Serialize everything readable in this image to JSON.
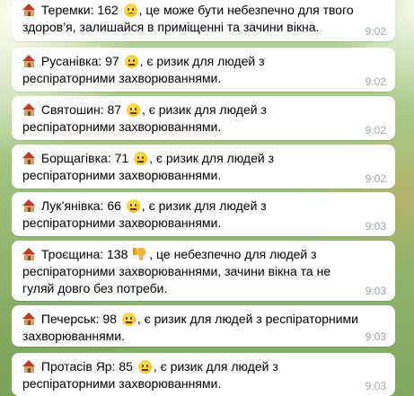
{
  "messages": [
    {
      "text_pre": "Теремки: 162",
      "emoji": "neutral-face-icon",
      "text_post": ", це може бути небезпечно для твого здоров’я, залишайся в приміщенні та зачини вікна.",
      "time": "9:02"
    },
    {
      "text_pre": "Русанівка: 97",
      "emoji": "neutral-face-icon",
      "text_post": ", є ризик для людей з респіраторними захворюваннями.",
      "time": "9:02"
    },
    {
      "text_pre": "Святошин: 87",
      "emoji": "neutral-face-icon",
      "text_post": ", є ризик для людей з респіраторними захворюваннями.",
      "time": "9:02"
    },
    {
      "text_pre": "Борщагівка: 71",
      "emoji": "neutral-face-icon",
      "text_post": ", є ризик для людей з респіраторними захворюваннями.",
      "time": "9:02"
    },
    {
      "text_pre": "Лук’янівка: 66",
      "emoji": "neutral-face-icon",
      "text_post": ", є ризик для людей з респіраторними захворюваннями.",
      "time": "9:03"
    },
    {
      "text_pre": "Троєщина: 138",
      "emoji": "thumbs-down-icon",
      "text_post": ", це небезпечно для людей з респіраторними захворюваннями, зачини вікна та не гуляй довго без потреби.",
      "time": "9:03"
    },
    {
      "text_pre": "Печерськ: 98",
      "emoji": "neutral-face-icon",
      "text_post": ", є ризик для людей з респіраторними захворюваннями.",
      "time": "9:03"
    },
    {
      "text_pre": "Протасів Яр: 85",
      "emoji": "neutral-face-icon",
      "text_post": ", є ризик для людей з респіраторними захворюваннями.",
      "time": "9:03"
    }
  ]
}
